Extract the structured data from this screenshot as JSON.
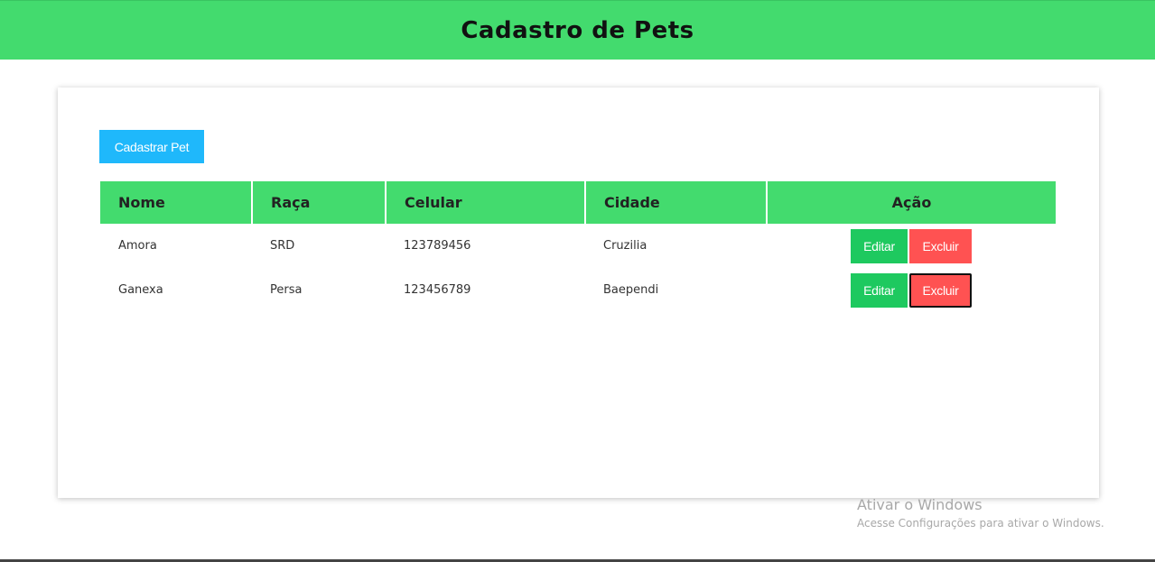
{
  "header": {
    "title": "Cadastro de Pets"
  },
  "toolbar": {
    "add_label": "Cadastrar Pet"
  },
  "table": {
    "columns": [
      "Nome",
      "Raça",
      "Celular",
      "Cidade",
      "Ação"
    ],
    "rows": [
      {
        "nome": "Amora",
        "raca": "SRD",
        "celular": "123789456",
        "cidade": "Cruzilia",
        "edit_label": "Editar",
        "delete_label": "Excluir"
      },
      {
        "nome": "Ganexa",
        "raca": "Persa",
        "celular": "123456789",
        "cidade": "Baependi",
        "edit_label": "Editar",
        "delete_label": "Excluir"
      }
    ]
  },
  "watermark": {
    "title": "Ativar o Windows",
    "subtitle": "Acesse Configurações para ativar o Windows."
  },
  "colors": {
    "header_bg": "#43db6e",
    "add_button": "#1fb8fb",
    "edit_button": "#1ec95f",
    "delete_button": "#ff5252"
  }
}
